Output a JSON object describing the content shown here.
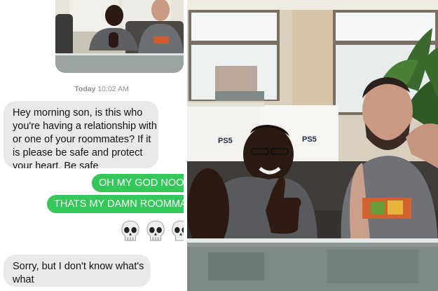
{
  "conversation": {
    "timestamp_day": "Today",
    "timestamp_time": "10:02 AM",
    "messages": [
      {
        "direction": "incoming",
        "lines": [
          "Hey morning son, is this who",
          "you're having a relationship with",
          "or one of your roommates? If it",
          "is please be safe and protect",
          "your heart. Be safe"
        ]
      },
      {
        "direction": "outgoing",
        "text": "OH MY GOD NOOO"
      },
      {
        "direction": "outgoing",
        "text": "THATS MY DAMN ROOMMAT"
      },
      {
        "direction": "outgoing",
        "reaction": "skull-emoji",
        "count": 3
      },
      {
        "direction": "incoming",
        "lines": [
          "Sorry, but I don't know what's",
          "what"
        ]
      }
    ]
  },
  "photo": {
    "box_label_left": "PS5",
    "box_label_right": "PS5"
  },
  "colors": {
    "incoming_bubble": "#e9e9eb",
    "outgoing_bubble": "#34c759",
    "timestamp": "#8e8e93"
  }
}
